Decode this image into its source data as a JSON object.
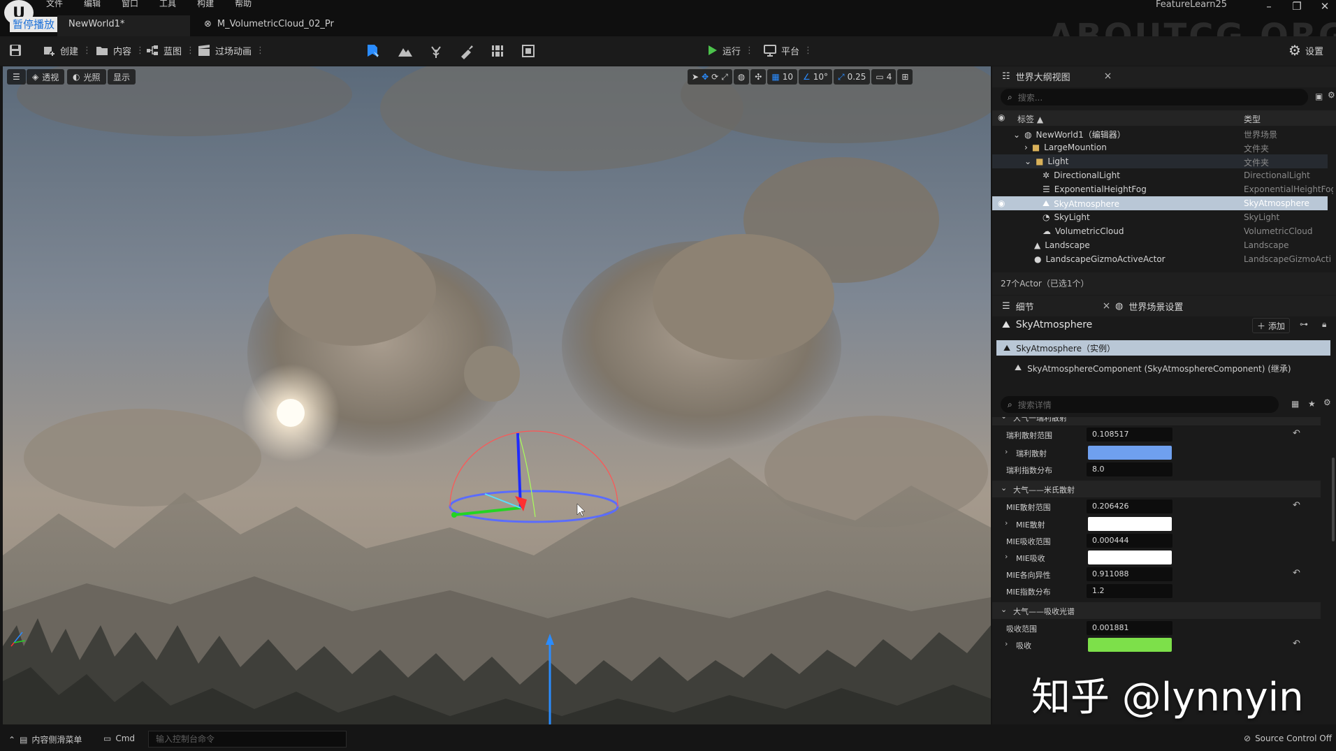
{
  "menu": [
    "文件",
    "编辑",
    "窗口",
    "工具",
    "构建",
    "帮助"
  ],
  "pause_badge": "暂停播放",
  "tabs": [
    {
      "label": "NewWorld1*"
    },
    {
      "label": "M_VolumetricCloud_02_Pr"
    }
  ],
  "app_title": "FeatureLearn25",
  "watermark_top": "ABOUTCG.ORG",
  "toolbar": {
    "create": "创建",
    "content": "内容",
    "blueprint": "蓝图",
    "cinematics": "过场动画",
    "run": "运行",
    "platform": "平台",
    "settings": "设置"
  },
  "viewport": {
    "perspective": "透视",
    "lighting": "光照",
    "show": "显示",
    "grid_snap": "10",
    "rotation_snap": "10°",
    "scale_snap": "0.25",
    "camera_speed": "4"
  },
  "outliner": {
    "tab": "世界大纲视图",
    "search_placeholder": "搜索...",
    "col_label": "标签",
    "col_type": "类型",
    "rows": [
      {
        "name": "NewWorld1（编辑器）",
        "type": "世界场景"
      },
      {
        "name": "LargeMountion",
        "type": "文件夹"
      },
      {
        "name": "Light",
        "type": "文件夹"
      },
      {
        "name": "DirectionalLight",
        "type": "DirectionalLight"
      },
      {
        "name": "ExponentialHeightFog",
        "type": "ExponentialHeightFog"
      },
      {
        "name": "SkyAtmosphere",
        "type": "SkyAtmosphere"
      },
      {
        "name": "SkyLight",
        "type": "SkyLight"
      },
      {
        "name": "VolumetricCloud",
        "type": "VolumetricCloud"
      },
      {
        "name": "Landscape",
        "type": "Landscape"
      },
      {
        "name": "LandscapeGizmoActiveActor",
        "type": "LandscapeGizmoActi"
      }
    ],
    "footer": "27个Actor（已选1个）"
  },
  "details": {
    "tab": "细节",
    "world_settings_tab": "世界场景设置",
    "actor_name": "SkyAtmosphere",
    "add_button": "添加",
    "instance_row": "SkyAtmosphere（实例）",
    "component_row": "SkyAtmosphereComponent (SkyAtmosphereComponent) (继承)",
    "search_placeholder": "搜索详情",
    "cut_section": "大气一瑞利散射",
    "rayleigh_rows": [
      {
        "label": "瑞利散射范围",
        "value": "0.108517",
        "reset": true
      },
      {
        "label": "瑞利散射",
        "color": "#6fa0ef"
      },
      {
        "label": "瑞利指数分布",
        "value": "8.0"
      }
    ],
    "mie_section": "大气——米氏散射",
    "mie_rows": [
      {
        "label": "MIE散射范围",
        "value": "0.206426",
        "reset": true
      },
      {
        "label": "MIE散射",
        "color": "#ffffff"
      },
      {
        "label": "MIE吸收范围",
        "value": "0.000444"
      },
      {
        "label": "MIE吸收",
        "color": "#ffffff"
      },
      {
        "label": "MIE各向异性",
        "value": "0.911088",
        "reset": true
      },
      {
        "label": "MIE指数分布",
        "value": "1.2"
      }
    ],
    "absorption_section": "大气——吸收光谱",
    "absorption_rows": [
      {
        "label": "吸收范围",
        "value": "0.001881"
      },
      {
        "label": "吸收",
        "color": "#7de04a"
      }
    ]
  },
  "statusbar": {
    "content_drawer": "内容侧滑菜单",
    "cmd": "Cmd",
    "console_placeholder": "输入控制台命令",
    "source_control": "Source Control Off"
  },
  "watermark_zhihu": "知乎 @lynnyin",
  "colors": {
    "selection": "#b9c7d6",
    "accent_blue": "#2a8cff",
    "run_green": "#4cc24c"
  }
}
